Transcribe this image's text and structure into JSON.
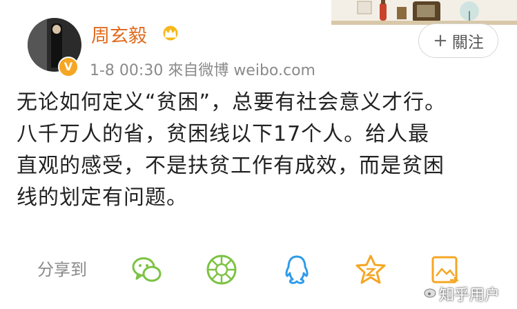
{
  "post": {
    "username": "周玄毅",
    "meta": "1-8 00:30  來自微博 weibo.com",
    "follow_label": "關注",
    "body_lines": [
      "无论如何定义“贫困”，总要有社会意义才行。",
      "八千万人的省，贫困线以下17个人。给人最",
      "直观的感受，不是扶贫工作有成效，而是贫困",
      "线的划定有问题。"
    ]
  },
  "share": {
    "label": "分享到",
    "targets": [
      "wechat-icon",
      "moments-icon",
      "qq-icon",
      "qzone-icon",
      "image-share-icon"
    ]
  },
  "watermark": "知乎用户",
  "colors": {
    "username": "#e06b1e",
    "verified_badge": "#f6a623",
    "share_green": "#7cc242",
    "share_blue": "#2f9be8",
    "share_orange": "#f5a623",
    "meta_gray": "#8a8a8a"
  }
}
